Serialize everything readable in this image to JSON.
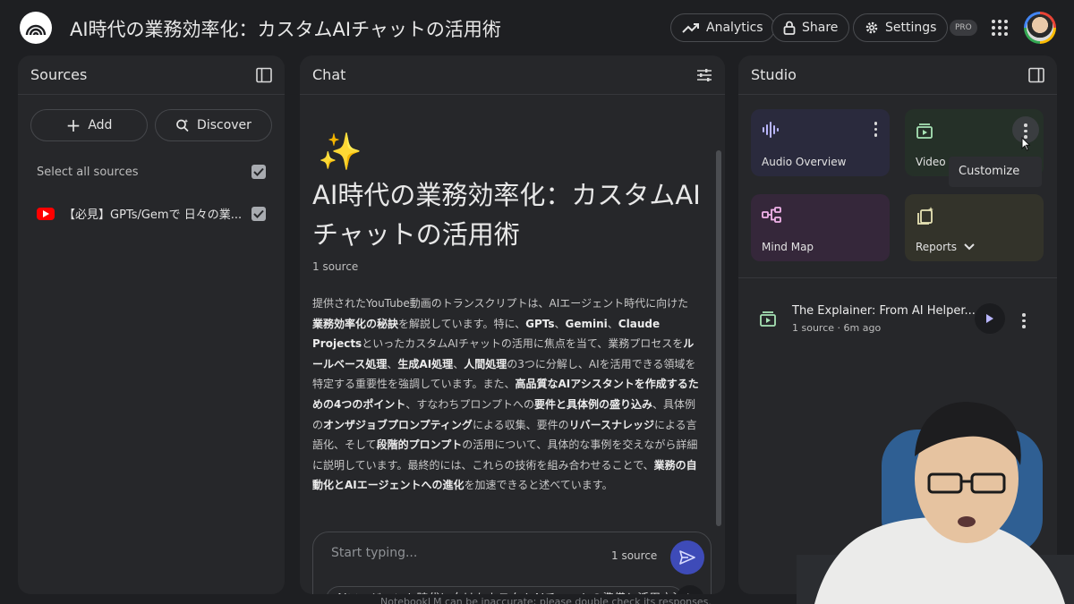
{
  "header": {
    "title": "AI時代の業務効率化：カスタムAIチャットの活用術",
    "analytics_label": "Analytics",
    "share_label": "Share",
    "settings_label": "Settings",
    "pro_label": "PRO"
  },
  "sources": {
    "title": "Sources",
    "add_label": "Add",
    "discover_label": "Discover",
    "select_all_label": "Select all sources",
    "items": [
      {
        "label": "【必見】GPTs/Gemで 日々の業...",
        "checked": true
      }
    ]
  },
  "chat": {
    "title": "Chat",
    "notebook_title": "AI時代の業務効率化：カスタムAIチャットの活用術",
    "source_count": "1 source",
    "summary": [
      {
        "t": "提供されたYouTube動画のトランスクリプトは、AIエージェント時代に向けた"
      },
      {
        "t": "業務効率化の秘訣",
        "b": true
      },
      {
        "t": "を解説しています。特に、"
      },
      {
        "t": "GPTs",
        "b": true
      },
      {
        "t": "、"
      },
      {
        "t": "Gemini",
        "b": true
      },
      {
        "t": "、"
      },
      {
        "t": "Claude Projects",
        "b": true
      },
      {
        "t": "といったカスタムAIチャットの活用に焦点を当て、業務プロセスを"
      },
      {
        "t": "ルールベース処理",
        "b": true
      },
      {
        "t": "、"
      },
      {
        "t": "生成AI処理",
        "b": true
      },
      {
        "t": "、"
      },
      {
        "t": "人間処理",
        "b": true
      },
      {
        "t": "の3つに分解し、AIを活用できる領域を特定する重要性を強調しています。また、"
      },
      {
        "t": "高品質なAIアシスタントを作成するための4つのポイント",
        "b": true
      },
      {
        "t": "、すなわちプロンプトへの"
      },
      {
        "t": "要件と具体例の盛り込み",
        "b": true
      },
      {
        "t": "、具体例の"
      },
      {
        "t": "オンザジョブプロンプティング",
        "b": true
      },
      {
        "t": "による収集、要件の"
      },
      {
        "t": "リバースナレッジ",
        "b": true
      },
      {
        "t": "による言語化、そして"
      },
      {
        "t": "段階的プロンプト",
        "b": true
      },
      {
        "t": "の活用について、具体的な事例を交えながら詳細に説明しています。最終的には、これらの技術を組み合わせることで、"
      },
      {
        "t": "業務の自動化とAIエージェントへの進化",
        "b": true
      },
      {
        "t": "を加速できると述べています。"
      }
    ],
    "input_placeholder": "Start typing...",
    "input_source_count": "1 source",
    "suggestion": "AIエージェント時代に向けたカスタムAIチャットの準備と活用方法",
    "disclaimer": "NotebookLM can be inaccurate; please double check its responses."
  },
  "studio": {
    "title": "Studio",
    "tiles": {
      "audio": "Audio Overview",
      "video": "Video Overview",
      "mindmap": "Mind Map",
      "reports": "Reports"
    },
    "tooltip": "Customize",
    "note": {
      "title": "The Explainer: From AI Helper...",
      "meta": "1 source · 6m ago"
    }
  },
  "colors": {
    "background": "#1e1f22",
    "panel": "#26272a",
    "accent_send": "#3e4bb8",
    "youtube": "#ff0000",
    "audio_tile": "#2a2a3d",
    "video_tile": "#253028",
    "mindmap_tile": "#35273a",
    "reports_tile": "#33332a"
  }
}
